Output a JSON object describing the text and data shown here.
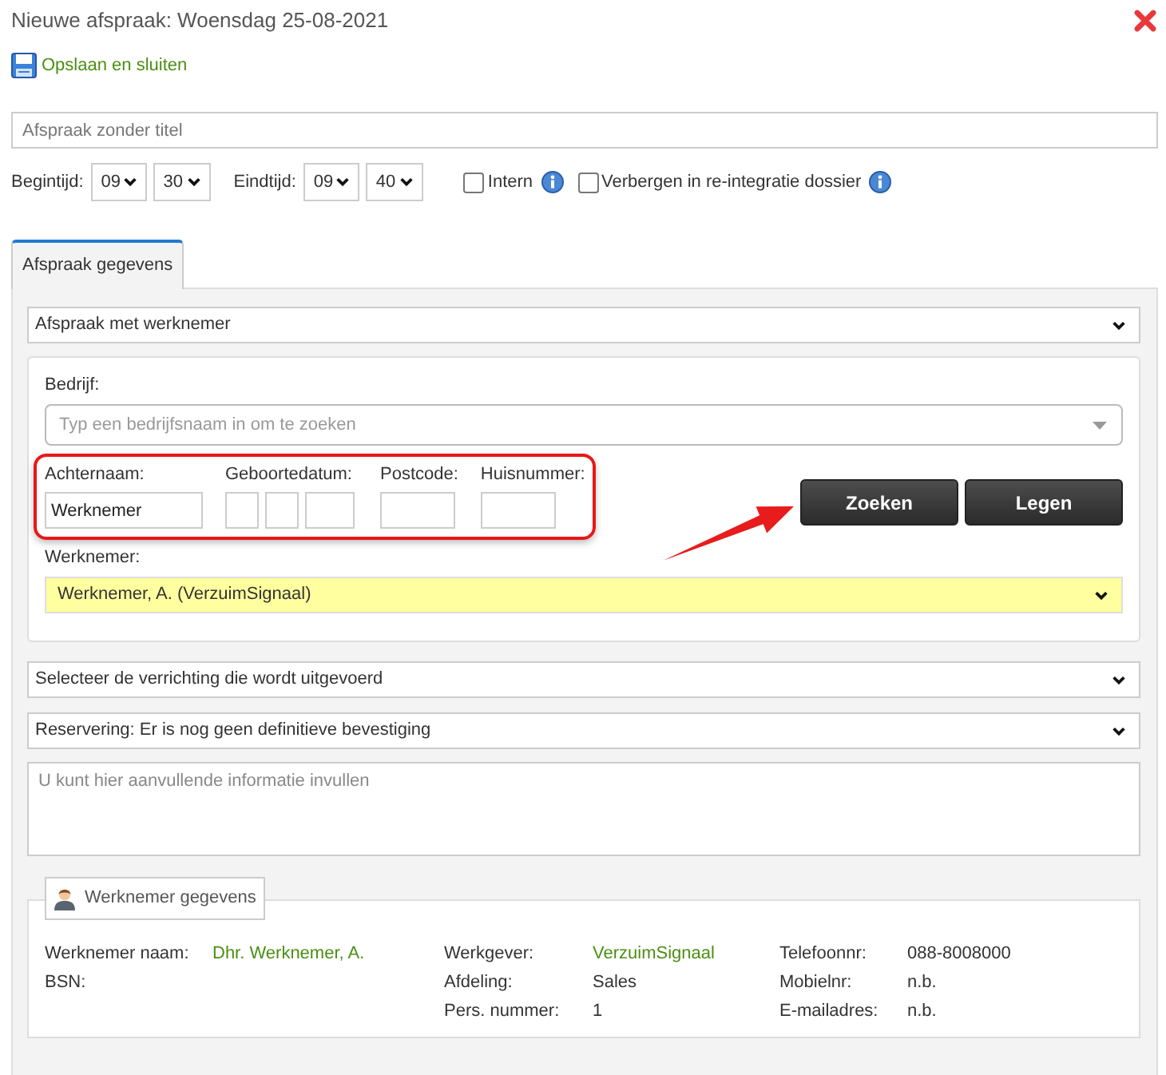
{
  "window": {
    "title": "Nieuwe afspraak: Woensdag 25-08-2021"
  },
  "toolbar": {
    "save": "Opslaan en sluiten"
  },
  "title_field": {
    "placeholder": "Afspraak zonder titel"
  },
  "times": [
    {
      "label": "Begintijd:",
      "hour": "09",
      "minute": "30"
    },
    {
      "label": "Eindtijd:",
      "hour": "09",
      "minute": "40"
    }
  ],
  "options": [
    {
      "label": "Intern",
      "checked": false
    },
    {
      "label": "Verbergen in re-integratie dossier",
      "checked": false
    }
  ],
  "tabs": [
    {
      "label": "Afspraak gegevens",
      "selected": true
    }
  ],
  "form": {
    "appointment_type": {
      "value": "Afspraak met werknemer"
    },
    "company": {
      "label": "Bedrijf:",
      "placeholder": "Typ een bedrijfsnaam in om te zoeken"
    },
    "search_fields": [
      {
        "label": "Achternaam:",
        "kind": "text",
        "value": "Werknemer"
      },
      {
        "label": "Geboortedatum:",
        "kind": "date"
      },
      {
        "label": "Postcode:",
        "kind": "text"
      },
      {
        "label": "Huisnummer:",
        "kind": "text"
      }
    ],
    "buttons": [
      "Zoeken",
      "Legen"
    ],
    "employee": {
      "label": "Werknemer:",
      "value": "Werknemer, A. (VerzuimSignaal)",
      "highlighted": true
    },
    "activity": {
      "value": "Selecteer de verrichting die wordt uitgevoerd"
    },
    "reservation": {
      "value": "Reservering: Er is nog geen definitieve bevestiging"
    },
    "notes": {
      "placeholder": "U kunt hier aanvullende informatie invullen"
    }
  },
  "employee_details": {
    "legend": "Werknemer gegevens",
    "columns": [
      [
        {
          "label": "Werknemer naam:",
          "value": "Dhr. Werknemer, A.",
          "link": true
        },
        {
          "label": "BSN:"
        }
      ],
      [
        {
          "label": "Werkgever:",
          "value": "VerzuimSignaal",
          "link": true
        },
        {
          "label": "Afdeling:",
          "value": "Sales",
          "link": false
        },
        {
          "label": "Pers. nummer:",
          "value": "1",
          "link": false
        }
      ],
      [
        {
          "label": "Telefoonnr:",
          "value": "088-8008000",
          "link": false
        },
        {
          "label": "Mobielnr:",
          "value": "n.b.",
          "link": false
        },
        {
          "label": "E-mailadres:",
          "value": "n.b.",
          "link": false
        }
      ]
    ]
  },
  "annotations": {
    "outline_box": true,
    "pointer_arrow": true
  }
}
